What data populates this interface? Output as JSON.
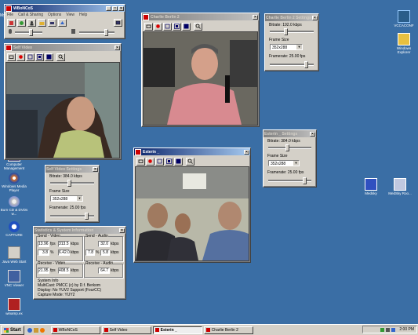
{
  "desktop": {
    "icons": [
      {
        "label": "VCCACONF"
      },
      {
        "label": "Windows Explorer"
      },
      {
        "label": "Computer Management"
      },
      {
        "label": "Windows Media Player"
      },
      {
        "label": "Burn CD & DVDs w..."
      },
      {
        "label": "CAPTURE"
      },
      {
        "label": "Java Web Start"
      },
      {
        "label": "VNC Viewer"
      },
      {
        "label": "winamp.ex"
      },
      {
        "label": "Medsky"
      },
      {
        "label": "MedSky Roo..."
      }
    ]
  },
  "main_app": {
    "title": "WBoNCoS",
    "menu": [
      "File",
      "Call & Sharing",
      "Options",
      "View",
      "Help"
    ],
    "label_my": "My"
  },
  "self_video": {
    "title": "Self Video"
  },
  "charlie_video": {
    "title": "Charlie Berlin 2"
  },
  "esterin_video": {
    "title": "Esterin _"
  },
  "charlie_settings": {
    "title": "Charlie Berlin 2 Settings",
    "bitrate": "Bitrate: 192.0 kbps",
    "frame_size_label": "Frame Size",
    "frame_size_value": "352x288",
    "framerate": "Framerate: 25.00 fps"
  },
  "esterin_settings": {
    "title": "Esterin _ Settings",
    "bitrate": "Bitrate: 384.0 kbps",
    "frame_size_label": "Frame Size",
    "frame_size_value": "352x288",
    "framerate": "Framerate: 25.00 fps"
  },
  "self_settings": {
    "title": "Self Video Settings",
    "bitrate": "Bitrate: 384.0 kbps",
    "frame_size_label": "Frame Size",
    "frame_size_value": "352x288",
    "framerate": "Framerate: 25.00 fps"
  },
  "stats": {
    "title": "Statistics & System Information",
    "send_video": "Send - Video",
    "send_audio": "Send - Audio",
    "recv_video": "Receive - Video",
    "recv_audio": "Receive - Audio",
    "sv_fps": "13.96",
    "sv_kbps": "313.5",
    "sa_kbps": "32.0",
    "sv_fps2": "3.8",
    "sv_kbps2": "6.42.0",
    "sa_pct": "7.8",
    "sa_kbps2": "5.8",
    "rv_fps": "21.95",
    "rv_kbps": "408.5",
    "ra_kbps": "64.7",
    "unit_fps": "fps",
    "unit_kbps": "kbps",
    "unit_pct": "%",
    "sys_info_label": "System Info",
    "sys_lines": [
      "MultiCast: PMCC (c) by D.f. Berkom",
      "Display: No YUV2 Support (FourCC)",
      "Capture Mode: YUY2"
    ]
  },
  "taskbar": {
    "start": "Start",
    "tasks": [
      "WBoNCoS",
      "Self Video",
      "Esterin _",
      "Charlie Berlin 2"
    ],
    "clock": "2:00 PM"
  }
}
